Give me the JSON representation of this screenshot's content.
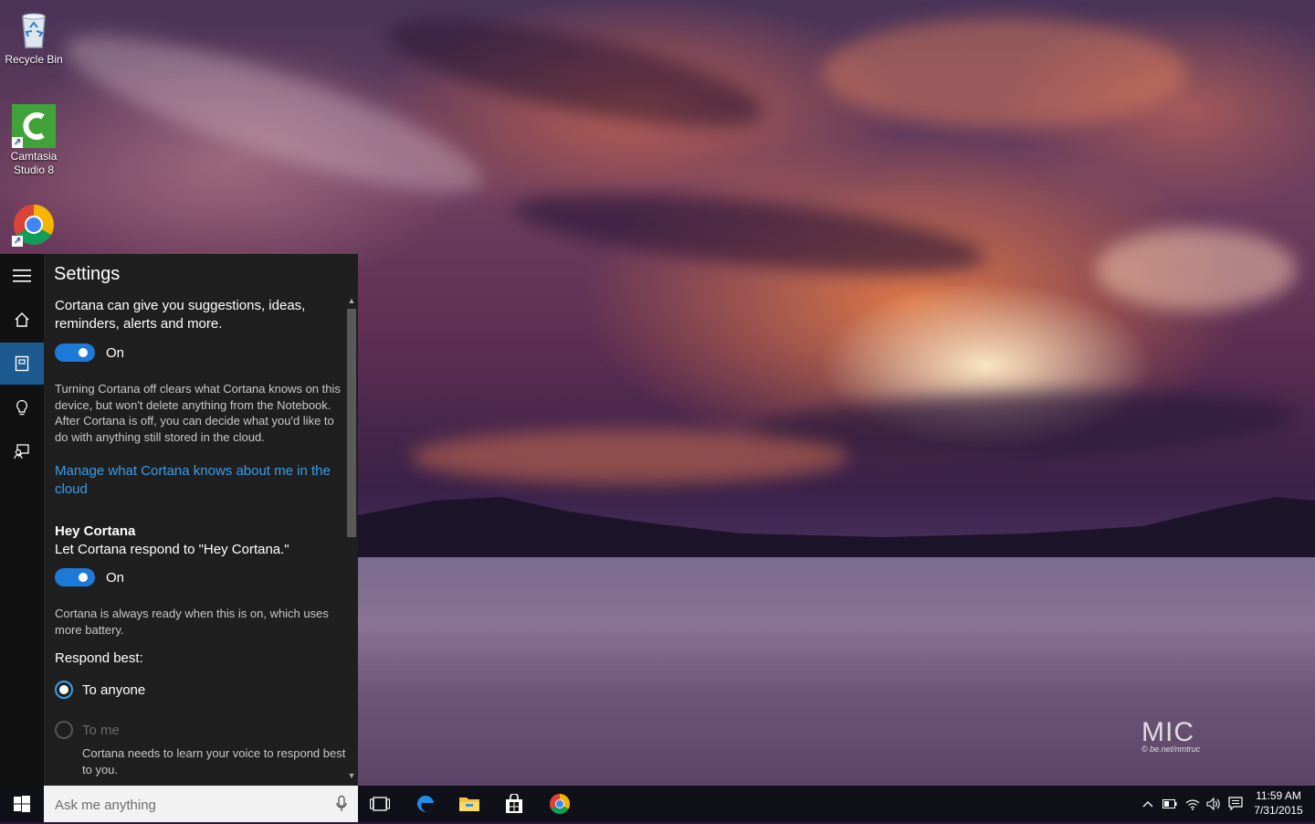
{
  "desktop": {
    "icons": [
      {
        "label": "Recycle Bin"
      },
      {
        "label": "Camtasia Studio 8"
      },
      {
        "label": "Google Chrome"
      }
    ],
    "watermark": {
      "logo": "MIC",
      "subtext": "© be.net/nmtruc"
    }
  },
  "cortana": {
    "title": "Settings",
    "rail": [
      "menu-icon",
      "home-icon",
      "notebook-icon",
      "lightbulb-icon",
      "feedback-icon"
    ],
    "intro": "Cortana can give you suggestions, ideas, reminders, alerts and more.",
    "toggle1_label": "On",
    "off_note": "Turning Cortana off clears what Cortana knows on this device, but won't delete anything from the Notebook. After Cortana is off, you can decide what you'd like to do with anything still stored in the cloud.",
    "manage_link": "Manage what Cortana knows about me in the cloud",
    "hey_title": "Hey Cortana",
    "hey_desc": "Let Cortana respond to \"Hey Cortana.\"",
    "toggle2_label": "On",
    "battery_note": "Cortana is always ready when this is on, which uses more battery.",
    "respond_label": "Respond best:",
    "radio_anyone": "To anyone",
    "radio_me": "To me",
    "learn_note": "Cortana needs to learn your voice to respond best to you.",
    "accent": "#1e7ad8"
  },
  "taskbar": {
    "search_placeholder": "Ask me anything",
    "time": "11:59 AM",
    "date": "7/31/2015"
  }
}
